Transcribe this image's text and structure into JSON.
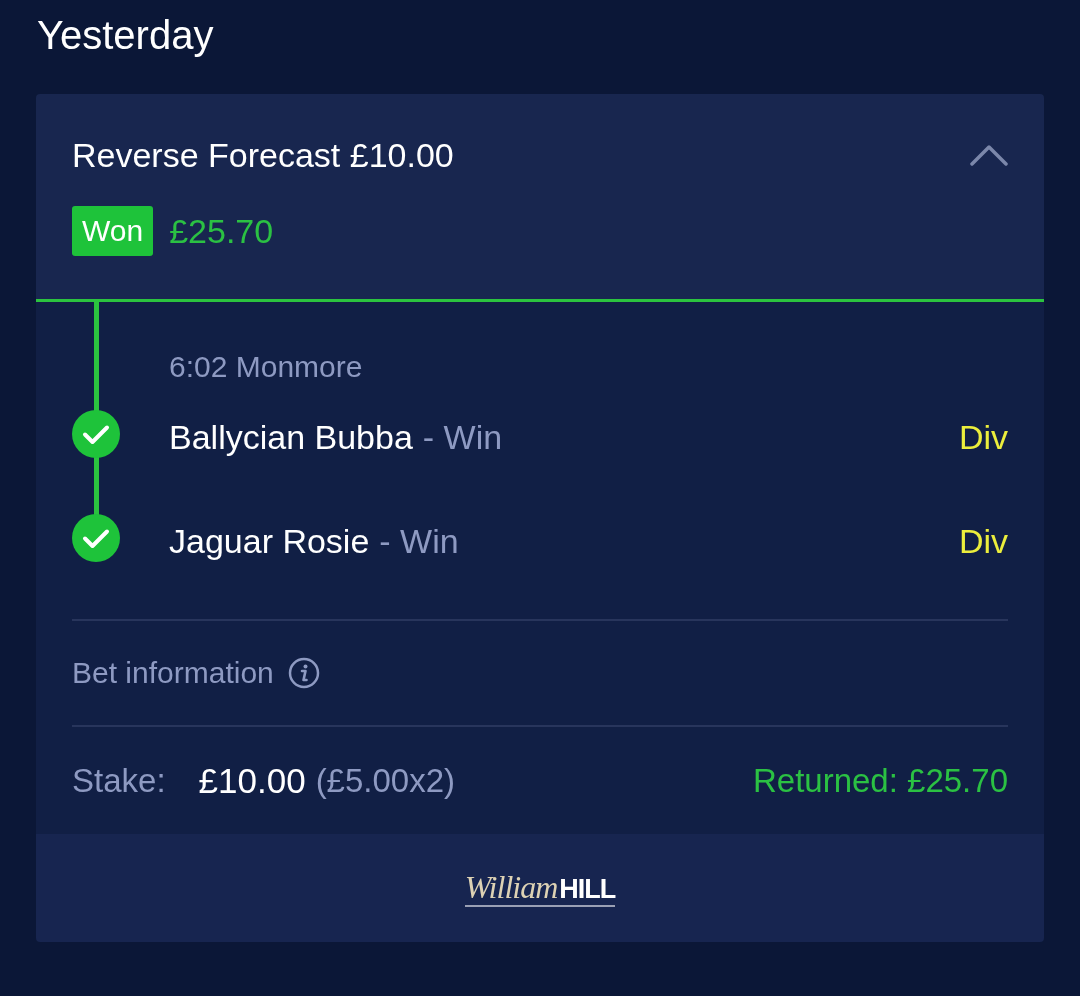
{
  "section_title": "Yesterday",
  "bet": {
    "title": "Reverse Forecast £10.00",
    "expanded": true,
    "status": {
      "label": "Won",
      "kind": "won"
    },
    "winnings": "£25.70",
    "event": "6:02 Monmore",
    "selections": [
      {
        "name": "Ballycian Bubba",
        "market": "- Win",
        "price": "Div",
        "settled": true
      },
      {
        "name": "Jaguar Rosie",
        "market": "- Win",
        "price": "Div",
        "settled": true
      }
    ],
    "info_label": "Bet information",
    "stake": {
      "label": "Stake:",
      "amount": "£10.00",
      "detail": "(£5.00x2)"
    },
    "returned": "Returned: £25.70"
  },
  "footer": {
    "logo_script": "William",
    "logo_bold": "HILL"
  }
}
